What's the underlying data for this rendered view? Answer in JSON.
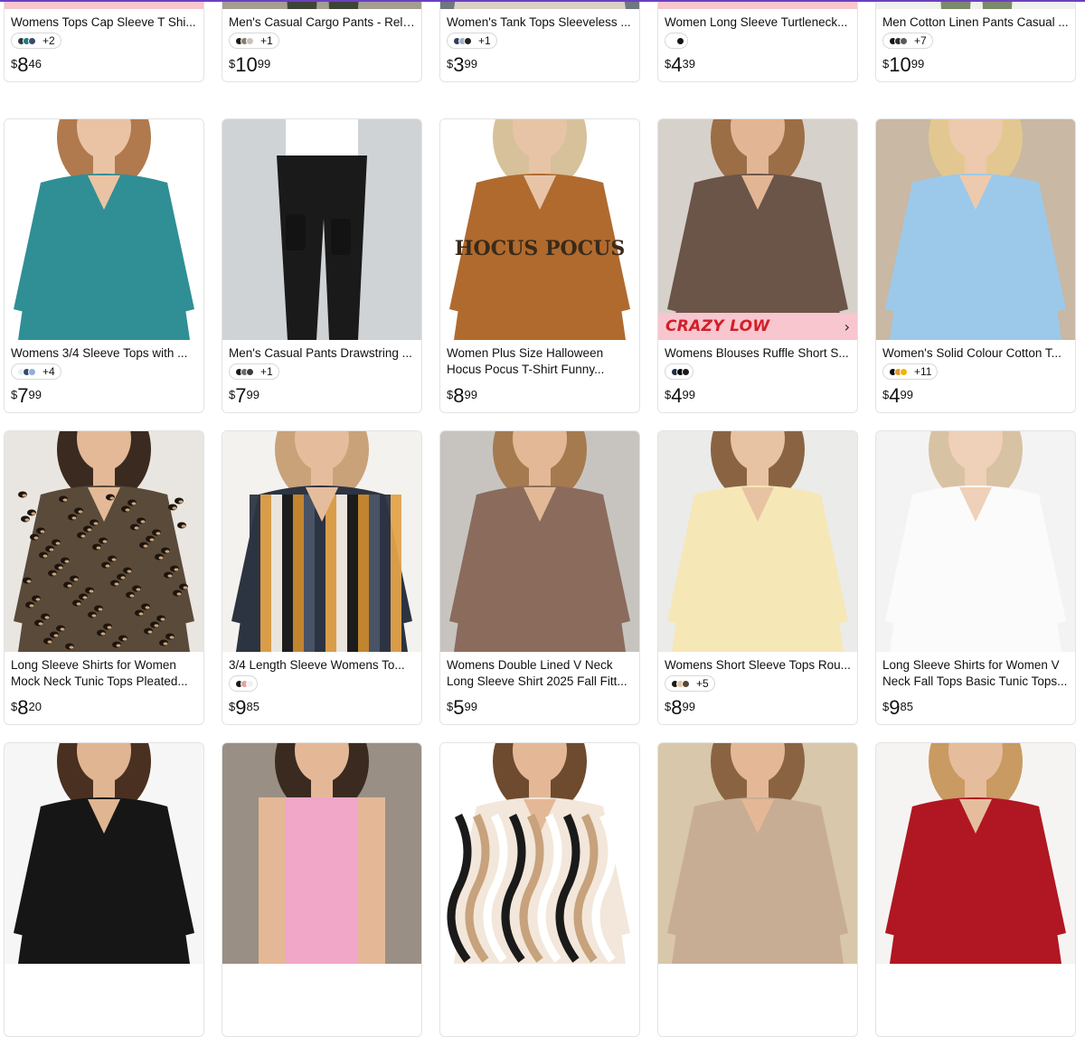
{
  "badge_label": "CRAZY LOW",
  "products": [
    {
      "title": "Womens Tops Cap Sleeve T Shi...",
      "swatches": [
        "#2f3a44",
        "#1d7c7a",
        "#384b6c"
      ],
      "more": "+2",
      "price": {
        "currency": "$",
        "whole": "8",
        "fraction": "46"
      },
      "crazy_low": true,
      "image": {
        "bg": "#f2f2f2",
        "garment": "#3d3a42",
        "skin": "#e5b896",
        "hair": "#6b4a34",
        "type": "top"
      }
    },
    {
      "title": "Men's Casual Cargo Pants - Rela...",
      "swatches": [
        "#1c1c1c",
        "#8a7c69",
        "#c7c3bb"
      ],
      "more": "+1",
      "price": {
        "currency": "$",
        "whole": "10",
        "fraction": "99"
      },
      "crazy_low": false,
      "image": {
        "bg": "#a39d92",
        "garment": "#3e4438",
        "skin": "#d9b49a",
        "hair": "#222",
        "type": "pants"
      }
    },
    {
      "title": "Women's Tank Tops Sleeveless ...",
      "swatches": [
        "#2e3e5c",
        "#9fb0c6",
        "#222"
      ],
      "more": "+1",
      "price": {
        "currency": "$",
        "whole": "3",
        "fraction": "99"
      },
      "crazy_low": false,
      "image": {
        "bg": "#6f7780",
        "garment": "#d8d0c5",
        "skin": "#e2b794",
        "hair": "#6b4a34",
        "type": "top"
      }
    },
    {
      "title": "Women Long Sleeve Turtleneck...",
      "swatches": [
        "#ffffff",
        "#141414"
      ],
      "more": "",
      "price": {
        "currency": "$",
        "whole": "4",
        "fraction": "39"
      },
      "crazy_low": true,
      "image": {
        "bg": "#f4f4f4",
        "garment": "#2a2a2a",
        "skin": "#e8c1a3",
        "hair": "#a47a52",
        "type": "top"
      }
    },
    {
      "title": "Men Cotton Linen Pants Casual ...",
      "swatches": [
        "#141414",
        "#2d2d2d",
        "#5a5a5a"
      ],
      "more": "+7",
      "price": {
        "currency": "$",
        "whole": "10",
        "fraction": "99"
      },
      "crazy_low": false,
      "image": {
        "bg": "#f0f0ee",
        "garment": "#7a8a6a",
        "skin": "#d8b092",
        "hair": "#333",
        "type": "pants"
      }
    },
    {
      "title": "Womens 3/4 Sleeve Tops with ...",
      "swatches": [
        "#e9eef5",
        "#2f4b7a",
        "#8fb0d6"
      ],
      "more": "+4",
      "price": {
        "currency": "$",
        "whole": "7",
        "fraction": "99"
      },
      "crazy_low": false,
      "image": {
        "bg": "#ffffff",
        "garment": "#2f8f95",
        "skin": "#e9c3a4",
        "hair": "#b07a4e",
        "type": "top"
      }
    },
    {
      "title": "Men's Casual Pants Drawstring ...",
      "swatches": [
        "#1c1c1c",
        "#6c6c6c",
        "#3b3b3b"
      ],
      "more": "+1",
      "price": {
        "currency": "$",
        "whole": "7",
        "fraction": "99"
      },
      "crazy_low": false,
      "image": {
        "bg": "#cfd3d6",
        "garment": "#1a1a1a",
        "skin": "#e5c2a4",
        "hair": "#333",
        "type": "pants"
      }
    },
    {
      "title": "Women Plus Size Halloween\nHocus Pocus T-Shirt Funny...",
      "swatches": [],
      "more": "",
      "price": {
        "currency": "$",
        "whole": "8",
        "fraction": "99"
      },
      "crazy_low": false,
      "image": {
        "bg": "#ffffff",
        "garment": "#b06a2e",
        "skin": "#e8c4a6",
        "hair": "#d7c19a",
        "type": "top",
        "print": "HOCUS POCUS"
      }
    },
    {
      "title": "Womens Blouses Ruffle Short S...",
      "swatches": [
        "#1f2b48",
        "#0b0b0b",
        "#1b1b1b"
      ],
      "more": "",
      "price": {
        "currency": "$",
        "whole": "4",
        "fraction": "99"
      },
      "crazy_low": true,
      "image": {
        "bg": "#d7d1cb",
        "garment": "#6b5448",
        "skin": "#e2b694",
        "hair": "#9b6e46",
        "type": "top"
      }
    },
    {
      "title": "Women's Solid Colour Cotton T...",
      "swatches": [
        "#0d0d0d",
        "#e59a2a",
        "#f0b400"
      ],
      "more": "+11",
      "price": {
        "currency": "$",
        "whole": "4",
        "fraction": "99"
      },
      "crazy_low": false,
      "image": {
        "bg": "#c8b8a4",
        "garment": "#9cc9ea",
        "skin": "#edc9ad",
        "hair": "#e2c890",
        "type": "top"
      }
    },
    {
      "title": "Long Sleeve Shirts for Women\nMock Neck Tunic Tops Pleated...",
      "swatches": [],
      "more": "",
      "price": {
        "currency": "$",
        "whole": "8",
        "fraction": "20"
      },
      "crazy_low": false,
      "image": {
        "bg": "#e9e6e1",
        "garment": "#5a4a3a",
        "skin": "#e3b997",
        "hair": "#3b2a20",
        "type": "leopard"
      }
    },
    {
      "title": "3/4 Length Sleeve Womens To...",
      "swatches": [
        "#1b1b1b",
        "#e6a19a",
        "#f1f1f1"
      ],
      "more": "",
      "price": {
        "currency": "$",
        "whole": "9",
        "fraction": "85"
      },
      "crazy_low": false,
      "image": {
        "bg": "#f3f2ef",
        "garment": "#2c3442",
        "skin": "#e5bd9c",
        "hair": "#c9a27a",
        "type": "stripes"
      }
    },
    {
      "title": "Womens Double Lined V Neck\nLong Sleeve Shirt 2025 Fall Fitt...",
      "swatches": [],
      "more": "",
      "price": {
        "currency": "$",
        "whole": "5",
        "fraction": "99"
      },
      "crazy_low": false,
      "image": {
        "bg": "#c7c4c0",
        "garment": "#8b6b5c",
        "skin": "#e3b896",
        "hair": "#a57a4f",
        "type": "top"
      }
    },
    {
      "title": "Womens Short Sleeve Tops Rou...",
      "swatches": [
        "#1a1a1a",
        "#e6c6a0",
        "#5a4636"
      ],
      "more": "+5",
      "price": {
        "currency": "$",
        "whole": "8",
        "fraction": "99"
      },
      "crazy_low": false,
      "image": {
        "bg": "#ebebea",
        "garment": "#f6e7b7",
        "skin": "#e8c3a3",
        "hair": "#8a6442",
        "type": "top"
      }
    },
    {
      "title": "Long Sleeve Shirts for Women V\nNeck Fall Tops Basic Tunic Tops...",
      "swatches": [],
      "more": "",
      "price": {
        "currency": "$",
        "whole": "9",
        "fraction": "85"
      },
      "crazy_low": false,
      "image": {
        "bg": "#f3f3f3",
        "garment": "#fbfbfb",
        "skin": "#efd0b8",
        "hair": "#d8c2a4",
        "type": "top"
      }
    },
    {
      "title": "",
      "swatches": [],
      "more": "",
      "price": {
        "currency": "",
        "whole": "",
        "fraction": ""
      },
      "crazy_low": false,
      "image": {
        "bg": "#f6f6f6",
        "garment": "#161616",
        "skin": "#e0b592",
        "hair": "#4a3020",
        "type": "top"
      }
    },
    {
      "title": "",
      "swatches": [],
      "more": "",
      "price": {
        "currency": "",
        "whole": "",
        "fraction": ""
      },
      "crazy_low": false,
      "image": {
        "bg": "#9a8f85",
        "garment": "#f0a7c8",
        "skin": "#e4b896",
        "hair": "#3b2a20",
        "type": "tank"
      }
    },
    {
      "title": "",
      "swatches": [],
      "more": "",
      "price": {
        "currency": "",
        "whole": "",
        "fraction": ""
      },
      "crazy_low": false,
      "image": {
        "bg": "#ffffff",
        "garment": "#f2e7da",
        "skin": "#e4b896",
        "hair": "#6e4a2e",
        "type": "print"
      }
    },
    {
      "title": "",
      "swatches": [],
      "more": "",
      "price": {
        "currency": "",
        "whole": "",
        "fraction": ""
      },
      "crazy_low": false,
      "image": {
        "bg": "#d8c7aa",
        "garment": "#c8ad95",
        "skin": "#e4b896",
        "hair": "#8a6442",
        "type": "top"
      }
    },
    {
      "title": "",
      "swatches": [],
      "more": "",
      "price": {
        "currency": "",
        "whole": "",
        "fraction": ""
      },
      "crazy_low": false,
      "image": {
        "bg": "#f6f4f2",
        "garment": "#b01722",
        "skin": "#e6bd9c",
        "hair": "#c99a62",
        "type": "top"
      }
    }
  ]
}
